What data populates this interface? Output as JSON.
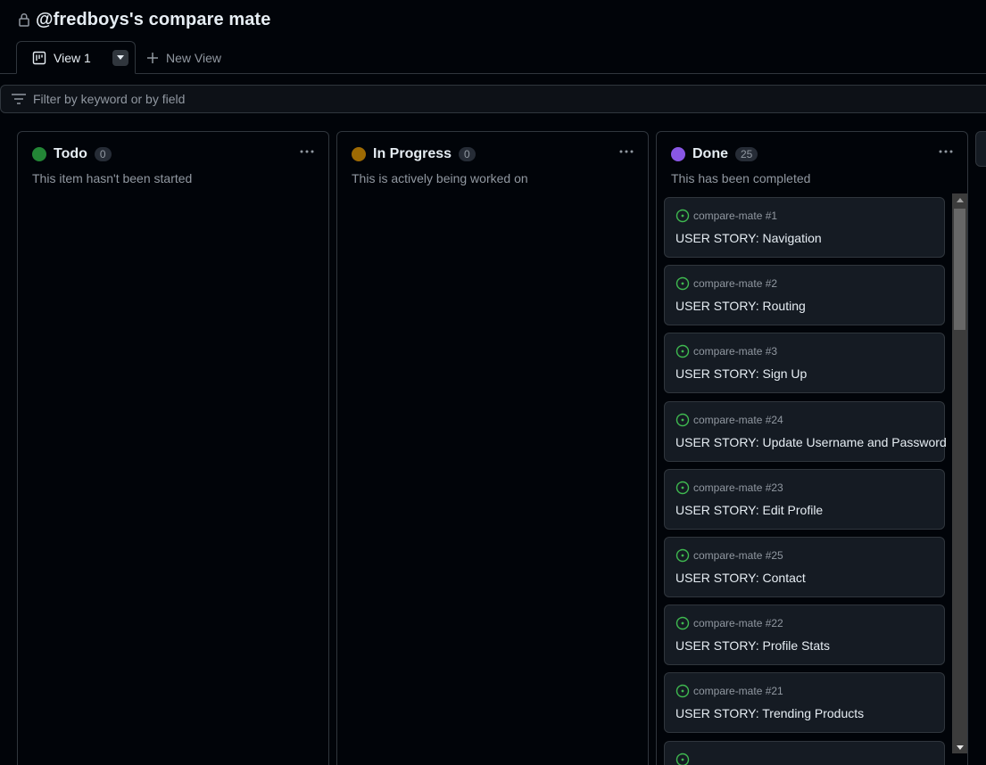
{
  "project": {
    "title": "@fredboys's compare mate",
    "lock_icon": "lock-icon"
  },
  "tabs": {
    "active_label": "View 1",
    "new_view_label": "New View"
  },
  "filter": {
    "placeholder": "Filter by keyword or by field",
    "value": ""
  },
  "columns": [
    {
      "name": "Todo",
      "count": "0",
      "description": "This item hasn't been started",
      "color": "#238636"
    },
    {
      "name": "In Progress",
      "count": "0",
      "description": "This is actively being worked on",
      "color": "#9e6a03"
    },
    {
      "name": "Done",
      "count": "25",
      "description": "This has been completed",
      "color": "#8957e5",
      "cards": [
        {
          "repo": "compare-mate #1",
          "title": "USER STORY: Navigation"
        },
        {
          "repo": "compare-mate #2",
          "title": "USER STORY: Routing"
        },
        {
          "repo": "compare-mate #3",
          "title": "USER STORY: Sign Up"
        },
        {
          "repo": "compare-mate #24",
          "title": "USER STORY: Update Username and Password"
        },
        {
          "repo": "compare-mate #23",
          "title": "USER STORY: Edit Profile"
        },
        {
          "repo": "compare-mate #25",
          "title": "USER STORY: Contact"
        },
        {
          "repo": "compare-mate #22",
          "title": "USER STORY: Profile Stats"
        },
        {
          "repo": "compare-mate #21",
          "title": "USER STORY: Trending Products"
        },
        {
          "repo": "",
          "title": ""
        }
      ]
    }
  ],
  "colors": {
    "background": "#010409",
    "border": "#30363d",
    "card": "#151b23",
    "open_issue": "#3fb950",
    "muted_text": "#9198a1"
  }
}
